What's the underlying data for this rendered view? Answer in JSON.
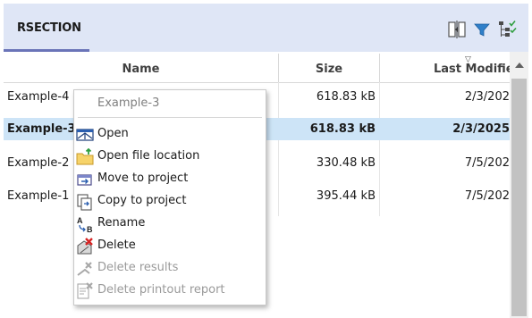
{
  "tab": {
    "label": "RSECTION"
  },
  "toolbar_icons": [
    "columns-layout-icon",
    "filter-icon",
    "tree-view-icon"
  ],
  "columns": {
    "name": "Name",
    "size": "Size",
    "modified": "Last Modified"
  },
  "rows": [
    {
      "name": "Example-4",
      "size": "618.83 kB",
      "modified": "2/3/202",
      "selected": false
    },
    {
      "name": "Example-3",
      "size": "618.83 kB",
      "modified": "2/3/2025",
      "selected": true
    },
    {
      "name": "Example-2",
      "size": "330.48 kB",
      "modified": "7/5/202",
      "selected": false
    },
    {
      "name": "Example-1",
      "size": "395.44 kB",
      "modified": "7/5/202",
      "selected": false
    }
  ],
  "context_menu": {
    "title": "Example-3",
    "items": [
      {
        "label": "Open",
        "icon": "open-model-icon",
        "enabled": true
      },
      {
        "label": "Open file location",
        "icon": "folder-icon",
        "enabled": true
      },
      {
        "label": "Move to project",
        "icon": "move-to-project-icon",
        "enabled": true
      },
      {
        "label": "Copy to project",
        "icon": "copy-to-project-icon",
        "enabled": true
      },
      {
        "label": "Rename",
        "icon": "rename-icon",
        "enabled": true
      },
      {
        "label": "Delete",
        "icon": "delete-icon",
        "enabled": true
      },
      {
        "label": "Delete results",
        "icon": "delete-results-icon",
        "enabled": false
      },
      {
        "label": "Delete printout report",
        "icon": "delete-printout-icon",
        "enabled": false
      }
    ]
  },
  "colors": {
    "toolbar_bg": "#dfe6f6",
    "tab_underline": "#6a74b8",
    "selected_row": "#cde4f7"
  }
}
